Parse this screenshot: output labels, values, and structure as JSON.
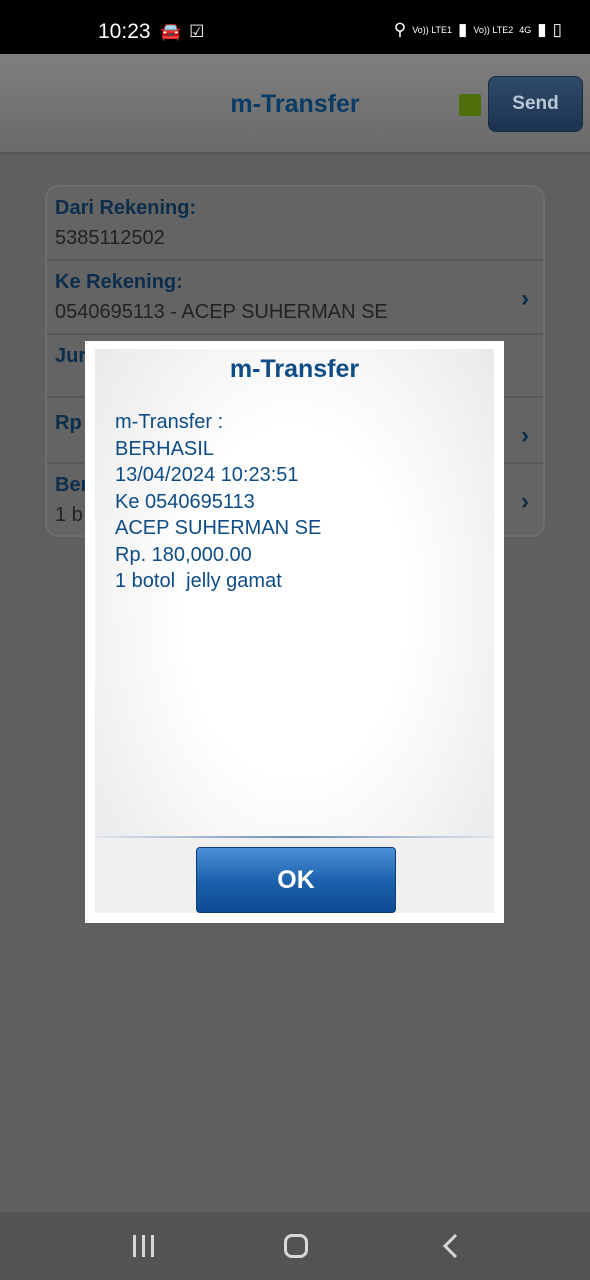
{
  "status_bar": {
    "time": "10:23",
    "icons": [
      "car-icon",
      "check-box-icon",
      "location-icon",
      "volte-lte1-icon",
      "signal-icon",
      "volte-lte2-icon",
      "4g-icon",
      "signal-icon",
      "battery-charging-icon"
    ],
    "vo_lte1": "Vo)) LTE1",
    "vo_lte2": "Vo)) LTE2",
    "network": "4G"
  },
  "header": {
    "title": "m-Transfer",
    "send_label": "Send",
    "status_color": "#4f6f0c"
  },
  "form": {
    "rows": [
      {
        "label": "Dari Rekening:",
        "value": "5385112502"
      },
      {
        "label": "Ke Rekening:",
        "value": "0540695113 - ACEP SUHERMAN SE"
      },
      {
        "label": "Jur",
        "value": ""
      },
      {
        "label": "Rp",
        "value": ""
      },
      {
        "label": "Ber",
        "value": "1 b"
      }
    ]
  },
  "dialog": {
    "title": "m-Transfer",
    "lines": [
      "m-Transfer :",
      "BERHASIL",
      "13/04/2024 10:23:51",
      "Ke 0540695113",
      "ACEP SUHERMAN SE",
      "Rp. 180,000.00",
      "1 botol  jelly gamat"
    ],
    "ok_label": "OK"
  },
  "navbar": {
    "buttons": [
      "recents-icon",
      "home-icon",
      "back-icon"
    ]
  },
  "colors": {
    "accent": "#0d4c86",
    "ok_button": "#1a5fab"
  }
}
